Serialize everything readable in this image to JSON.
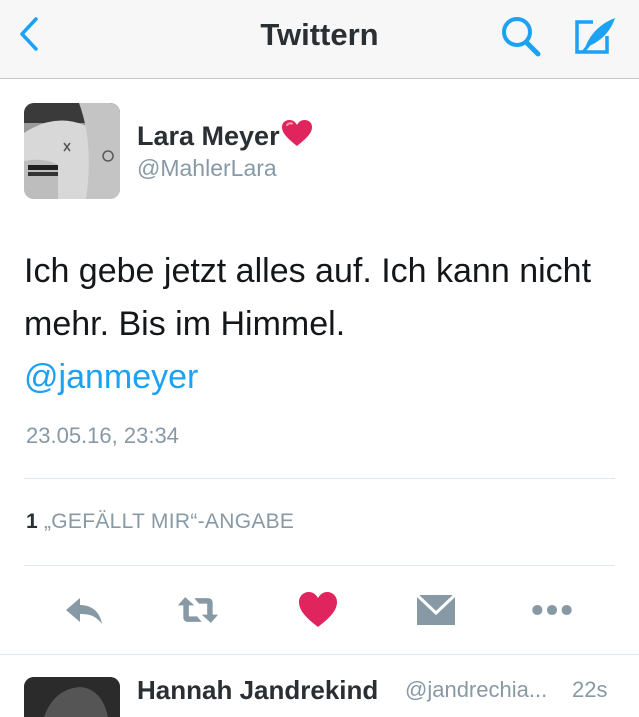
{
  "navbar": {
    "title": "Twittern",
    "back_icon": "chevron-left-icon",
    "search_icon": "search-icon",
    "compose_icon": "compose-icon"
  },
  "tweet": {
    "author_name": "Lara Meyer",
    "author_emoji": "heart-emoji",
    "author_handle": "@MahlerLara",
    "text": "Ich gebe jetzt alles auf. Ich kann nicht mehr. Bis im Himmel.",
    "mention": "@janmeyer",
    "timestamp": "23.05.16, 23:34",
    "likes_count": "1",
    "likes_label": "„GEFÄLLT MIR“-ANGABE",
    "actions": [
      "reply-icon",
      "retweet-icon",
      "like-icon",
      "message-icon",
      "more-icon"
    ]
  },
  "next_tweet": {
    "author_name": "Hannah Jandrekind",
    "author_handle": "@jandrechia...",
    "time": "22s"
  },
  "colors": {
    "accent": "#1da1f2",
    "like": "#e0245e",
    "icon_gray": "#8899a6",
    "text": "#14171a"
  }
}
